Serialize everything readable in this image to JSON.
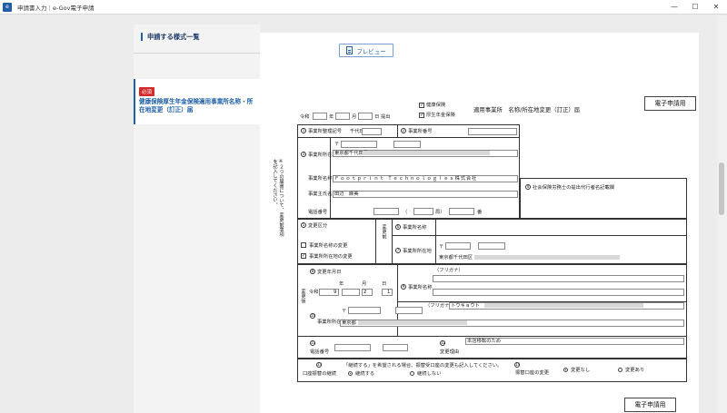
{
  "window": {
    "title": "申請書入力｜e-Gov電子申請",
    "app_icon": "egov-app-icon",
    "minimize": "—",
    "maximize": "☐",
    "close": "✕"
  },
  "sidebar": {
    "heading": "申請する様式一覧",
    "items": [
      {
        "badge": "必須",
        "label": "健康保険厚生年金保険適用事業所名称・所在地変更（訂正）届"
      }
    ]
  },
  "toolbar": {
    "preview_label": "プレビュー",
    "esubmit_label": "電子申請用"
  },
  "form": {
    "header": {
      "check_health": "健康保険",
      "check_pension": "厚生年金保険",
      "title": "適用事業所　名称/所在地変更（訂正）届",
      "era": "令和",
      "year_unit": "年",
      "month_unit": "月",
      "day_unit": "日",
      "year": "",
      "month": "",
      "day": "",
      "submit_label": "提出"
    },
    "side_note": "※２つの届書について、変更前事項を記入してください。",
    "sec_a": {
      "office_code_label": "事業所整理記号",
      "office_code_value": "千代田",
      "office_number_label": "事業所番号",
      "address_label": "事業所所在地",
      "postal_mark": "〒",
      "address_value": "東京都千代田区",
      "name_label": "事業所名称",
      "name_value": "Ｆｏｏｔｐｒｉｎｔ Ｔｅｃｈｎｏｌｏｇｉｅｓ株式会社",
      "owner_label": "事業主氏名",
      "owner_value": "田辺　麻美",
      "phone_label": "電話番号",
      "phone_open": "（",
      "phone_close": "局）",
      "phone_ban": "番"
    },
    "sec_agent": {
      "label": "社会保険労務士の提出代行者名記載欄"
    },
    "sec_change": {
      "kubun_label": "変更区分",
      "opt_name": "事業所名称の変更",
      "opt_addr": "事業所所在地の変更",
      "mae_label": "変更前",
      "name_label": "事業所名称",
      "addr_label": "事業所所在地",
      "postal_mark": "〒",
      "addr_value": "東京都千代田区"
    },
    "sec_after": {
      "date_label": "変更年月日",
      "era": "令和",
      "year_unit": "年",
      "month_unit": "月",
      "day_unit": "日",
      "era_code": "9",
      "month": "2",
      "day": "1",
      "ato_label": "変更後",
      "furigana_label": "（フリガナ）",
      "name_label": "事業所名称",
      "furigana_value": "トウキョウト",
      "addr_label": "事業所所在地",
      "postal_mark": "〒",
      "addr_value": "東京都",
      "phone_label": "電話番号",
      "reason_label": "変更理由",
      "reason_value": "本店移転のため"
    },
    "sec_account": {
      "label": "口座振替の継続",
      "note": "「継続する」を希望される場合、振替受口座の変更も記入してください。",
      "opt_continue": "継続する",
      "opt_stop": "継続しない",
      "change_label": "振替口座の変更",
      "opt_nochange": "変更なし",
      "opt_change": "変更あり"
    }
  }
}
